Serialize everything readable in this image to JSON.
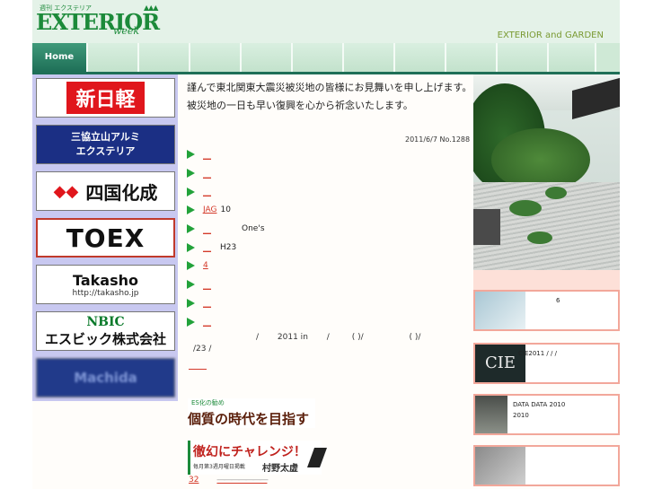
{
  "header": {
    "logo_main": "EXTERIOR",
    "logo_small": "週刊 エクステリア",
    "logo_script": "week",
    "tagline": "EXTERIOR and GARDEN"
  },
  "nav": {
    "home_label": "Home",
    "tab_count": 10
  },
  "sidebar": {
    "banners": [
      {
        "label": "新日軽"
      },
      {
        "line1": "三協立山アルミ",
        "line2": "エクステリア"
      },
      {
        "label": "四国化成"
      },
      {
        "label": "TOEX"
      },
      {
        "line1": "Takasho",
        "line2": "http://takasho.jp"
      },
      {
        "line1": "NBIC",
        "line2": "エスビック株式会社"
      },
      {
        "label": "Machida"
      }
    ]
  },
  "main": {
    "message_line1": "謹んで東北関東大震災被災地の皆様にお見舞いを申し上げます。",
    "message_line2": "被災地の一日も早い復興を心から祈念いたします。",
    "issue_date": "2011/6/7 No.1288",
    "news": [
      {
        "link": "＿",
        "text": ""
      },
      {
        "link": "＿",
        "text": ""
      },
      {
        "link": "＿",
        "text": ""
      },
      {
        "link": "JAG ",
        "text": "10"
      },
      {
        "link": "＿",
        "text": "One's"
      },
      {
        "link": "＿",
        "text": "H23"
      },
      {
        "link": "4 ",
        "text": ""
      },
      {
        "link": "＿",
        "text": ""
      },
      {
        "link": "＿",
        "text": ""
      },
      {
        "link": "＿",
        "text": ""
      }
    ],
    "tail_line1_a": "/",
    "tail_line1_b": "2011 in",
    "tail_line1_c": "/",
    "tail_line1_d": "(  )/",
    "tail_line1_e": "(  )/",
    "tail_line2": "/23   /",
    "banner1_small": "ES化の勧め",
    "banner1_main": "個質の時代を目指す",
    "banner2_main": "徹幻にチャレンジ！",
    "banner2_sub": "毎月第3週月曜日掲載",
    "banner2_right": "村野太虚",
    "link_32": "32"
  },
  "right": {
    "cards": [
      {
        "text": "6"
      },
      {
        "text": "CIE2011  /  /  /",
        "thumb": "CIE"
      },
      {
        "text": "DATA DATA 2010",
        "text2": "2010"
      },
      {
        "text": ""
      }
    ]
  },
  "colors": {
    "brand_green": "#1c8a3a",
    "nav_dark": "#1f6f57",
    "link_red": "#d43a2a",
    "sidebar_bg": "#c8c8f0",
    "card_border": "#f2a79a"
  }
}
